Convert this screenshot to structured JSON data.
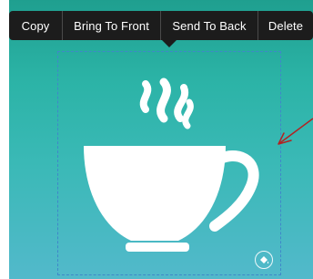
{
  "context_menu": {
    "items": [
      {
        "label": "Copy"
      },
      {
        "label": "Bring To Front"
      },
      {
        "label": "Send To Back"
      },
      {
        "label": "Delete"
      }
    ]
  },
  "canvas": {
    "selected_element": "coffee-cup-icon",
    "colors": {
      "background_top": "#1f9f8f",
      "background_bottom": "#52b9cb",
      "selection_border": "#3f88c9",
      "annotation_arrow": "#b22222",
      "menu_background": "#1c1c1c"
    }
  },
  "icons": {
    "selected_graphic": "coffee-cup-icon",
    "badge": "paint-bucket-icon",
    "annotation": "red-arrow-icon"
  }
}
